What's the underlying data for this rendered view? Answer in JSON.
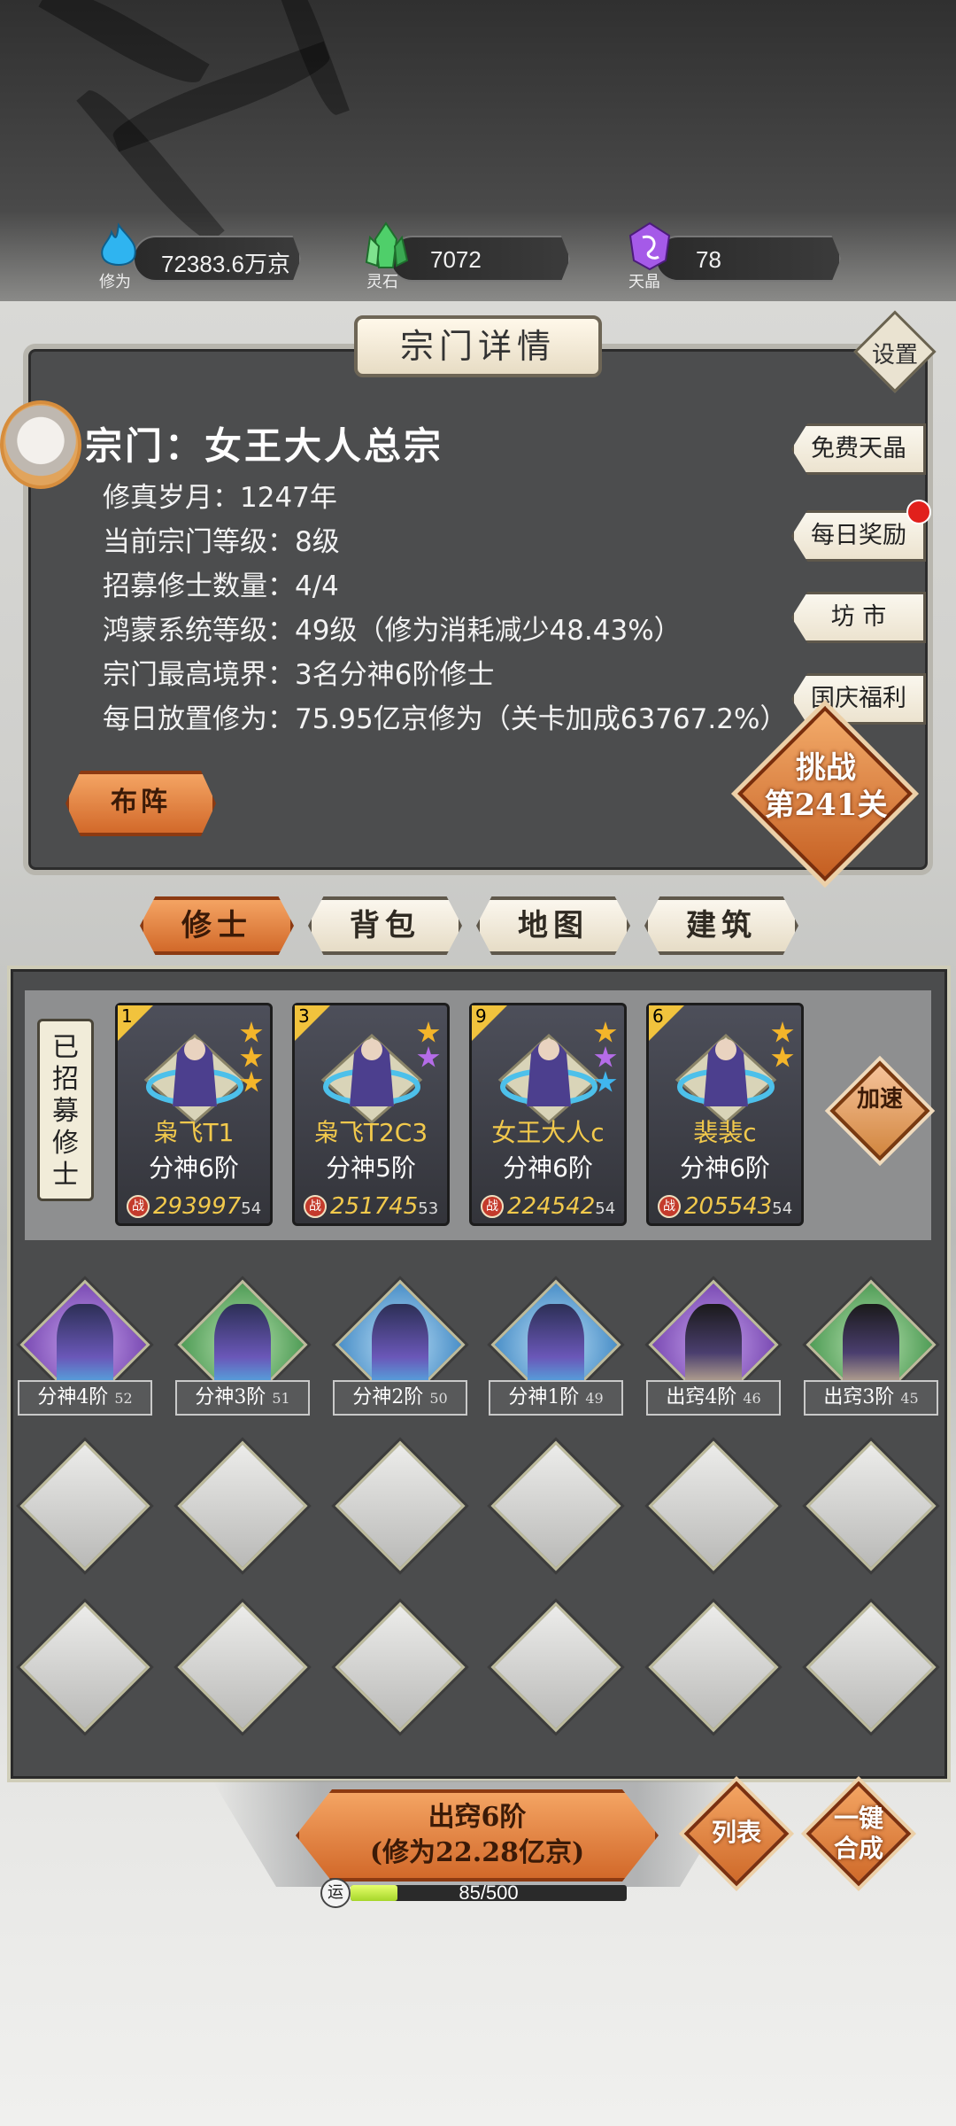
{
  "resources": [
    {
      "name": "修为",
      "value": "72383.6万京",
      "icon": "blue-flame-icon",
      "color": "#2fb4f0"
    },
    {
      "name": "灵石",
      "value": "7072",
      "icon": "green-crystal-icon",
      "color": "#4fcf6a"
    },
    {
      "name": "天晶",
      "value": "78",
      "icon": "purple-crystal-icon",
      "color": "#a55ae8"
    }
  ],
  "panel": {
    "title": "宗门详情",
    "settings_label": "设置",
    "sect_name": "宗门：女王大人总宗",
    "info": [
      "修真岁月：1247年",
      "当前宗门等级：8级",
      "招募修士数量：4/4",
      "鸿蒙系统等级：49级（修为消耗减少48.43%）",
      "宗门最高境界：3名分神6阶修士",
      "每日放置修为：75.95亿京修为（关卡加成63767.2%）"
    ],
    "side_buttons": [
      "免费天晶",
      "每日奖励",
      "坊 市",
      "国庆福利"
    ],
    "formation_label": "布阵",
    "challenge_line1": "挑战",
    "challenge_line2": "第241关"
  },
  "tabs": [
    {
      "label": "修士",
      "active": true
    },
    {
      "label": "背包",
      "active": false
    },
    {
      "label": "地图",
      "active": false
    },
    {
      "label": "建筑",
      "active": false
    }
  ],
  "recruited_label": "已招募修士",
  "speedup_label": "加速",
  "recruited": [
    {
      "slot": "1",
      "name": "枭飞T1",
      "rank": "分神6阶",
      "power": "293997",
      "level": "54",
      "stars": [
        "gold",
        "gold",
        "gold"
      ]
    },
    {
      "slot": "3",
      "name": "枭飞T2C3",
      "rank": "分神5阶",
      "power": "251745",
      "level": "53",
      "stars": [
        "gold",
        "purple"
      ]
    },
    {
      "slot": "9",
      "name": "女王大人c",
      "rank": "分神6阶",
      "power": "224542",
      "level": "54",
      "stars": [
        "gold",
        "purple",
        "blue"
      ]
    },
    {
      "slot": "6",
      "name": "裴裴c",
      "rank": "分神6阶",
      "power": "205543",
      "level": "54",
      "stars": [
        "gold",
        "gold"
      ]
    }
  ],
  "fight_badge": "战",
  "grid": [
    {
      "label": "分神4阶",
      "level": "52",
      "bg": "purple",
      "fig": "blue"
    },
    {
      "label": "分神3阶",
      "level": "51",
      "bg": "green",
      "fig": "blue"
    },
    {
      "label": "分神2阶",
      "level": "50",
      "bg": "blue",
      "fig": "blue"
    },
    {
      "label": "分神1阶",
      "level": "49",
      "bg": "blue",
      "fig": "blue"
    },
    {
      "label": "出窍4阶",
      "level": "46",
      "bg": "purple",
      "fig": "dark"
    },
    {
      "label": "出窍3阶",
      "level": "45",
      "bg": "green",
      "fig": "dark"
    }
  ],
  "bottom": {
    "breakthrough_line1": "出窍6阶",
    "breakthrough_line2": "(修为22.28亿京)",
    "list_label": "列表",
    "merge_label_1": "一键",
    "merge_label_2": "合成",
    "luck_icon": "运",
    "luck_text": "85/500",
    "luck_value": 85,
    "luck_max": 500
  }
}
